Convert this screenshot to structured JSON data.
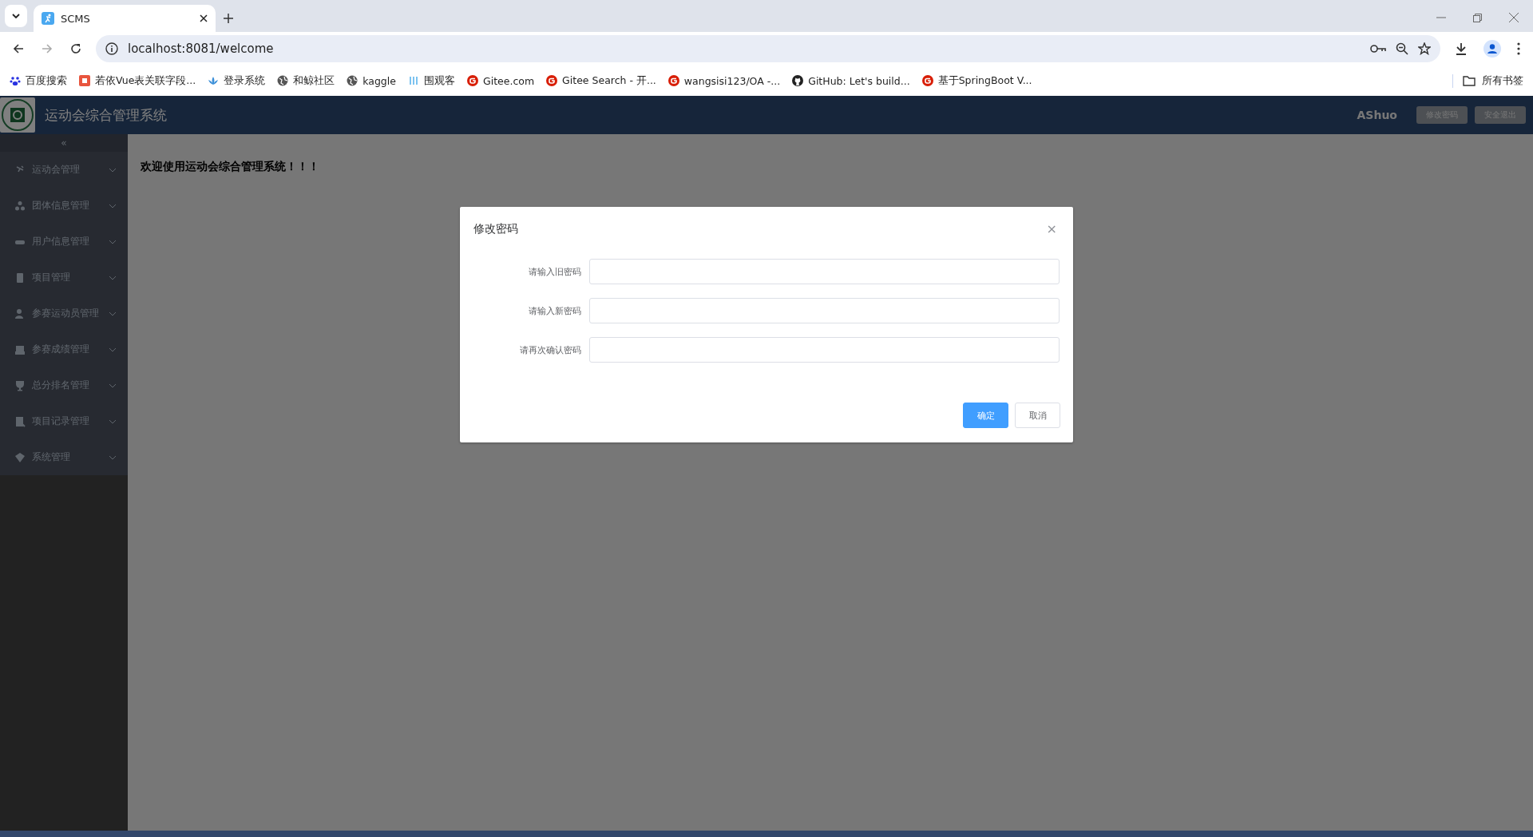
{
  "browser": {
    "tab": {
      "title": "SCMS"
    },
    "address": "localhost:8081/welcome",
    "bookmarks": [
      "百度搜索",
      "若依Vue表关联字段...",
      "登录系统",
      "和鲸社区",
      "kaggle",
      "围观客",
      "Gitee.com",
      "Gitee Search - 开...",
      "wangsisi123/OA -...",
      "GitHub: Let's build...",
      "基于SpringBoot V..."
    ],
    "all_bookmarks": "所有书签"
  },
  "header": {
    "title": "运动会综合管理系统",
    "user": "AShuo",
    "buttons": [
      "修改密码",
      "安全退出"
    ]
  },
  "sidebar": {
    "collapse": "«",
    "items": [
      "运动会管理",
      "团体信息管理",
      "用户信息管理",
      "项目管理",
      "参赛运动员管理",
      "参赛成绩管理",
      "总分排名管理",
      "项目记录管理",
      "系统管理"
    ]
  },
  "main": {
    "welcome": "欢迎使用运动会综合管理系统！！！"
  },
  "dialog": {
    "title": "修改密码",
    "close": "×",
    "fields": [
      {
        "label": "请输入旧密码"
      },
      {
        "label": "请输入新密码"
      },
      {
        "label": "请再次确认密码"
      }
    ],
    "buttons": [
      {
        "label": "确定",
        "kind": "primary"
      },
      {
        "label": "取消",
        "kind": "default"
      }
    ]
  }
}
